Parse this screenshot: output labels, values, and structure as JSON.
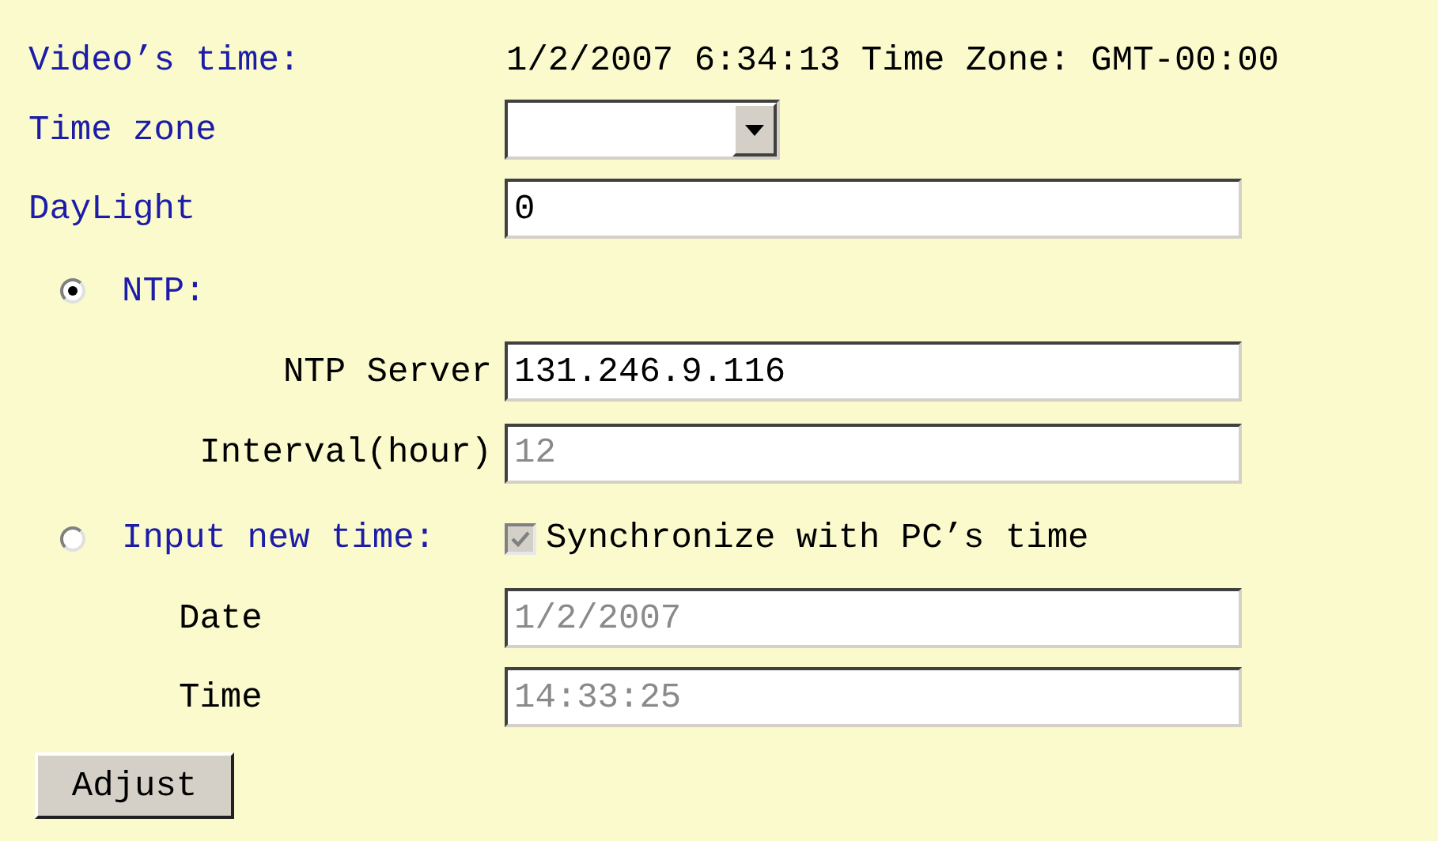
{
  "video_time": {
    "label": "Video’s time:",
    "value": "1/2/2007 6:34:13 Time Zone: GMT-00:00"
  },
  "time_zone": {
    "label": "Time zone"
  },
  "daylight": {
    "label": "DayLight",
    "value": "0"
  },
  "modes": [
    {
      "kind": "ntp",
      "label": "NTP:",
      "selected": true,
      "fields": [
        {
          "label": "NTP Server",
          "value": "131.246.9.116",
          "disabled": false
        },
        {
          "label": "Interval(hour)",
          "value": "12",
          "disabled": true
        }
      ]
    },
    {
      "kind": "manual",
      "label": "Input new time:",
      "selected": false,
      "sync": {
        "label": "Synchronize with PC’s time",
        "checked": true,
        "disabled": true
      },
      "fields": [
        {
          "label": "Date",
          "value": "1/2/2007",
          "disabled": true
        },
        {
          "label": "Time",
          "value": "14:33:25",
          "disabled": true
        }
      ]
    }
  ],
  "buttons": [
    "Adjust"
  ]
}
